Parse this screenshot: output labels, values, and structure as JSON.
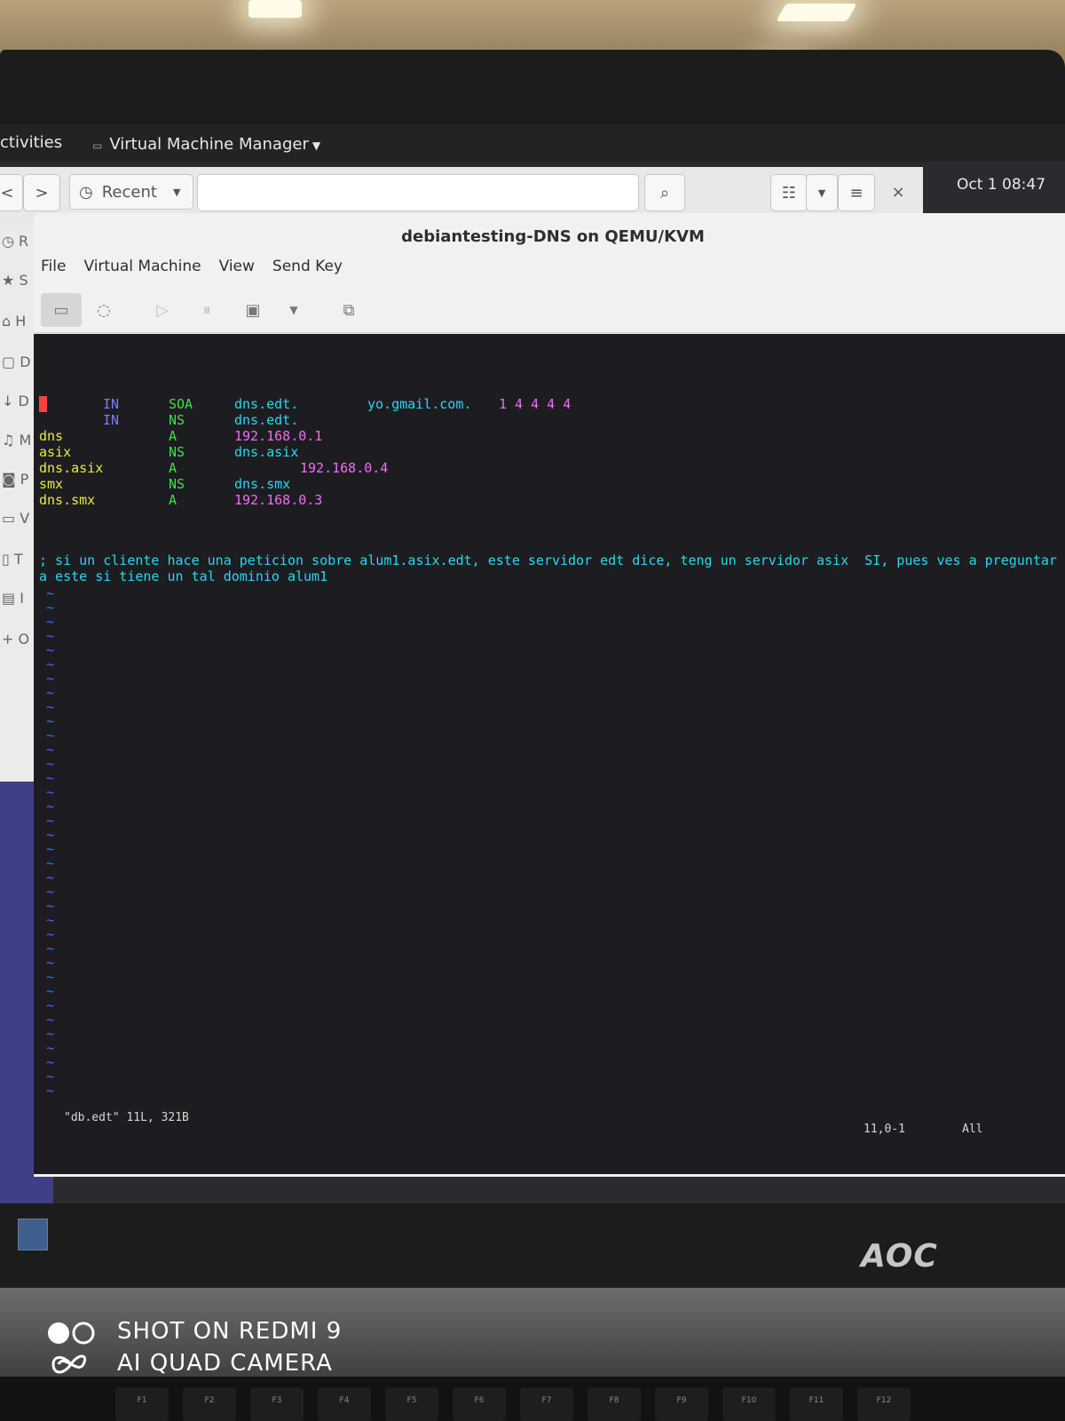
{
  "topbar": {
    "activities": "ctivities",
    "app_menu": "Virtual Machine Manager",
    "clock": "Oct 1  08:47"
  },
  "file_chooser": {
    "back": "<",
    "forward": ">",
    "recent_label": "Recent",
    "sidebar_letters": [
      "R",
      "S",
      "H",
      "D",
      "D",
      "M",
      "P",
      "V",
      "T",
      "I",
      "O"
    ]
  },
  "vm_window": {
    "title": "debiantesting-DNS on QEMU/KVM",
    "menu": [
      "File",
      "Virtual Machine",
      "View",
      "Send Key"
    ],
    "close": "×"
  },
  "console": {
    "records": [
      {
        "name": "@",
        "class": "IN",
        "type": "SOA",
        "data": "dns.edt.",
        "extra": "yo.gmail.com.",
        "nums": "1 4 4 4 4"
      },
      {
        "name": "",
        "class": "IN",
        "type": "NS",
        "data": "dns.edt.",
        "extra": "",
        "nums": ""
      },
      {
        "name": "dns",
        "class": "",
        "type": "A",
        "data": "192.168.0.1",
        "extra": "",
        "nums": ""
      },
      {
        "name": "asix",
        "class": "",
        "type": "NS",
        "data": "dns.asix",
        "extra": "",
        "nums": ""
      },
      {
        "name": "dns.asix",
        "class": "",
        "type": "A",
        "data": "192.168.0.4",
        "extra": "",
        "nums": ""
      },
      {
        "name": "smx",
        "class": "",
        "type": "NS",
        "data": "dns.smx",
        "extra": "",
        "nums": ""
      },
      {
        "name": "dns.smx",
        "class": "",
        "type": "A",
        "data": "192.168.0.3",
        "extra": "",
        "nums": ""
      }
    ],
    "comment_line1": "; si un cliente hace una peticion sobre alum1.asix.edt, este servidor edt dice, teng un servidor asix  SI, pues ves a preguntar",
    "comment_line2": "a este si tiene un tal dominio alum1",
    "status_file": "\"db.edt\" 11L, 321B",
    "cursor_pos": "11,0-1",
    "view_pct": "All"
  },
  "monitor": {
    "brand": "AOC"
  },
  "keyboard": {
    "keys": [
      "F1",
      "F2",
      "F3",
      "F4",
      "F5",
      "F6",
      "F7",
      "F8",
      "F9",
      "F10",
      "F11",
      "F12"
    ]
  },
  "watermark": {
    "line1": "SHOT ON REDMI 9",
    "line2": "AI QUAD CAMERA"
  }
}
